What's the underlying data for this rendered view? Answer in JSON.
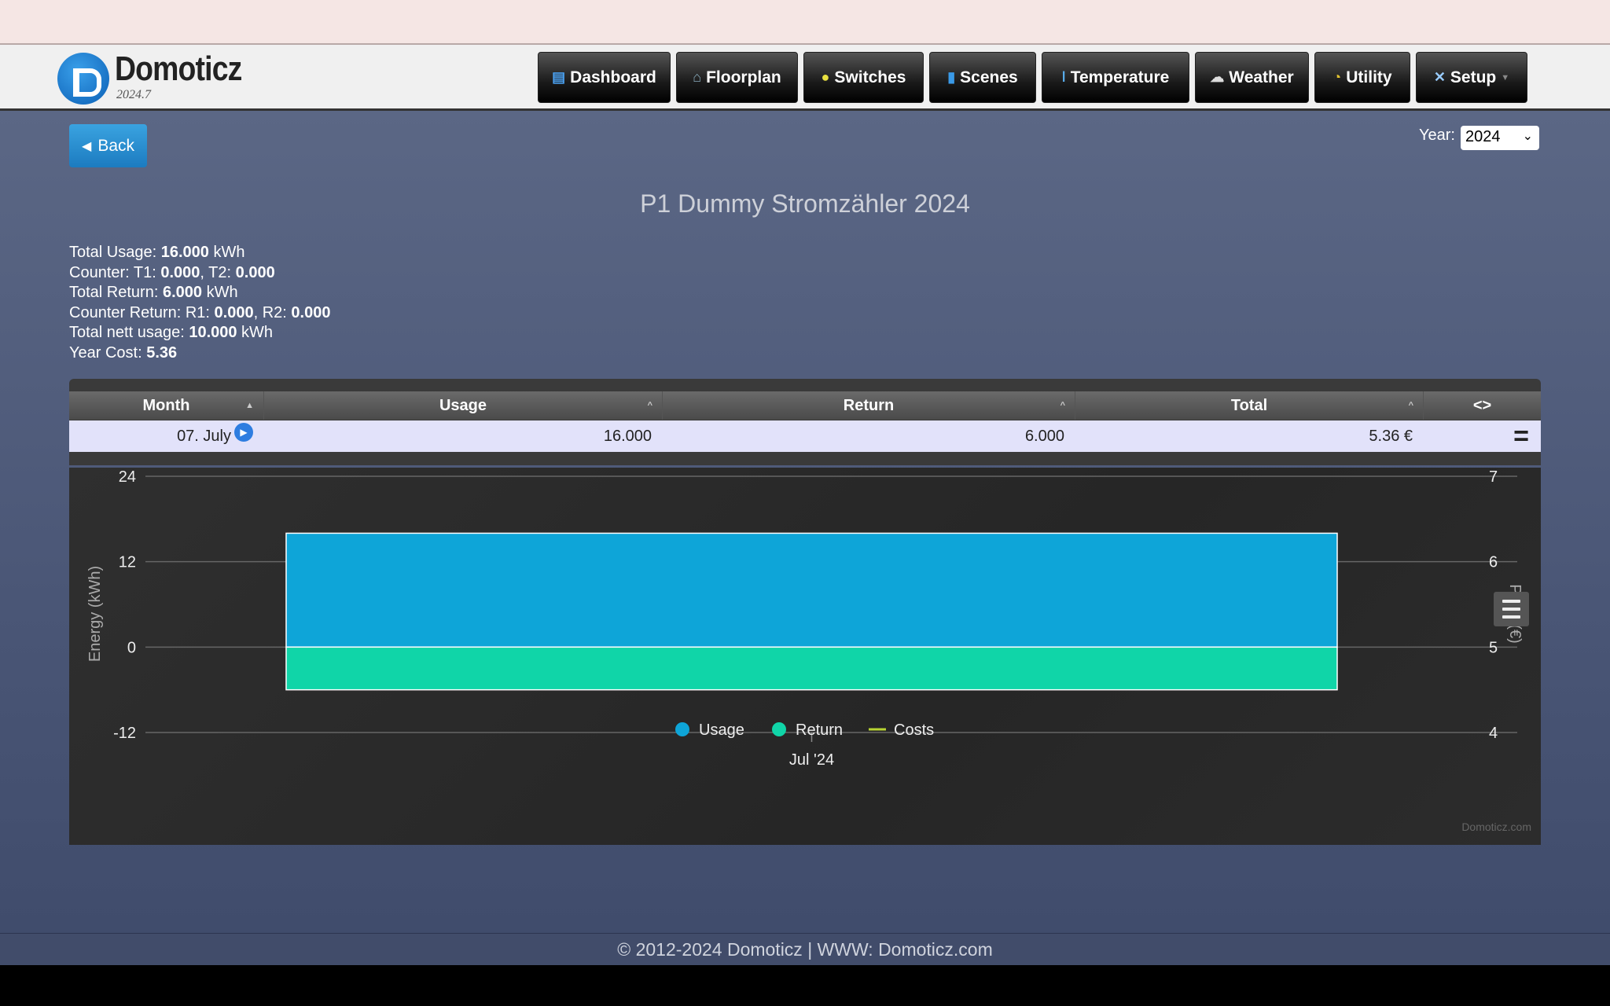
{
  "app": {
    "brand": "Domoticz",
    "version": "2024.7"
  },
  "nav": [
    {
      "label": "Dashboard",
      "icon": "dashboard-icon"
    },
    {
      "label": "Floorplan",
      "icon": "floorplan-icon"
    },
    {
      "label": "Switches",
      "icon": "bulb-icon"
    },
    {
      "label": "Scenes",
      "icon": "clapper-icon"
    },
    {
      "label": "Temperature",
      "icon": "thermometer-icon"
    },
    {
      "label": "Weather",
      "icon": "cloud-rain-icon"
    },
    {
      "label": "Utility",
      "icon": "gauge-icon"
    },
    {
      "label": "Setup",
      "icon": "tools-icon"
    }
  ],
  "back_label": "Back",
  "year": {
    "label": "Year:",
    "value": "2024"
  },
  "title": "P1 Dummy Stromzähler 2024",
  "stats": {
    "usage_label": "Total Usage: ",
    "usage": "16.000",
    "usage_unit": " kWh",
    "counter_label": "Counter: T1: ",
    "t1": "0.000",
    "t2_label": ", T2: ",
    "t2": "0.000",
    "return_label": "Total Return: ",
    "ret": "6.000",
    "return_unit": " kWh",
    "counter_return_label": "Counter Return: R1: ",
    "r1": "0.000",
    "r2_label": ", R2: ",
    "r2": "0.000",
    "nett_label": "Total nett usage: ",
    "nett": "10.000",
    "nett_unit": " kWh",
    "cost_label": "Year Cost: ",
    "cost": "5.36"
  },
  "table": {
    "headers": [
      "Month",
      "Usage",
      "Return",
      "Total",
      "<>"
    ],
    "rows": [
      {
        "month": "07. July",
        "usage": "16.000",
        "return": "6.000",
        "total": "5.36 €"
      }
    ]
  },
  "chart_data": {
    "type": "bar",
    "categories": [
      "Jul '24"
    ],
    "series": [
      {
        "name": "Usage",
        "values": [
          16
        ],
        "color": "#0ea5d8"
      },
      {
        "name": "Return",
        "values": [
          -6
        ],
        "color": "#10d5a8"
      },
      {
        "name": "Costs",
        "values": [
          5.36
        ],
        "color": "#b8d432"
      }
    ],
    "ylabel": "Energy (kWh)",
    "y2label": "Price (€)",
    "ylim": [
      -12,
      24
    ],
    "yticks": [
      "24",
      "12",
      "0",
      "-12"
    ],
    "y2lim": [
      4,
      7
    ],
    "y2ticks": [
      "7",
      "6",
      "5",
      "4"
    ],
    "grid": true,
    "legend": "bottom-center",
    "credit": "Domoticz.com"
  },
  "footer": {
    "text": "© 2012-2024 Domoticz | WWW: ",
    "link": "Domoticz.com"
  }
}
